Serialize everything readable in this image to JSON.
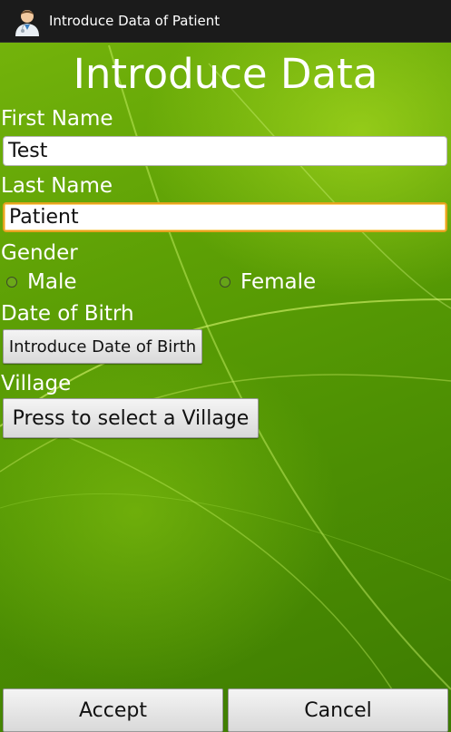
{
  "action_bar": {
    "title": "Introduce Data of Patient",
    "icon": "doctor-avatar-icon"
  },
  "form": {
    "title": "Introduce Data",
    "first_name": {
      "label": "First Name",
      "value": "Test"
    },
    "last_name": {
      "label": "Last Name",
      "value": "Patient"
    },
    "gender": {
      "label": "Gender",
      "options": [
        "Male",
        "Female"
      ],
      "selected": null
    },
    "date_of_birth": {
      "label": "Date of Bitrh",
      "button_label": "Introduce Date of Birth"
    },
    "village": {
      "label": "Village",
      "button_label": "Press to select a Village"
    }
  },
  "actions": {
    "accept_label": "Accept",
    "cancel_label": "Cancel"
  },
  "colors": {
    "background_green": "#5da005",
    "action_bar": "#1b1b1b",
    "focus_border": "#e6a21e"
  }
}
